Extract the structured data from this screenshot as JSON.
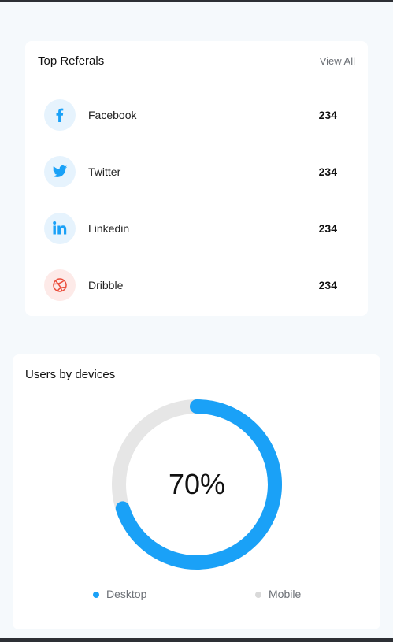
{
  "referrals": {
    "title": "Top Referals",
    "view_all": "View All",
    "items": [
      {
        "label": "Facebook",
        "value": "234",
        "icon": "facebook-icon"
      },
      {
        "label": "Twitter",
        "value": "234",
        "icon": "twitter-icon"
      },
      {
        "label": "Linkedin",
        "value": "234",
        "icon": "linkedin-icon"
      },
      {
        "label": "Dribble",
        "value": "234",
        "icon": "dribbble-icon"
      }
    ]
  },
  "devices": {
    "title": "Users by devices",
    "center_label": "70%",
    "legend": [
      {
        "label": "Desktop",
        "color": "#1aa1f7"
      },
      {
        "label": "Mobile",
        "color": "#d9d9d9"
      }
    ]
  },
  "chart_data": {
    "type": "pie",
    "categories": [
      "Desktop",
      "Mobile"
    ],
    "values": [
      70,
      30
    ],
    "title": "Users by devices",
    "colors": [
      "#1aa1f7",
      "#e6e6e6"
    ],
    "legend_position": "bottom"
  },
  "colors": {
    "accent": "#1aa1f7",
    "accent_light_bg": "#e6f3fd",
    "dribbble": "#ea4c3a",
    "dribbble_bg": "#fdeae8",
    "track": "#e6e6e6"
  }
}
